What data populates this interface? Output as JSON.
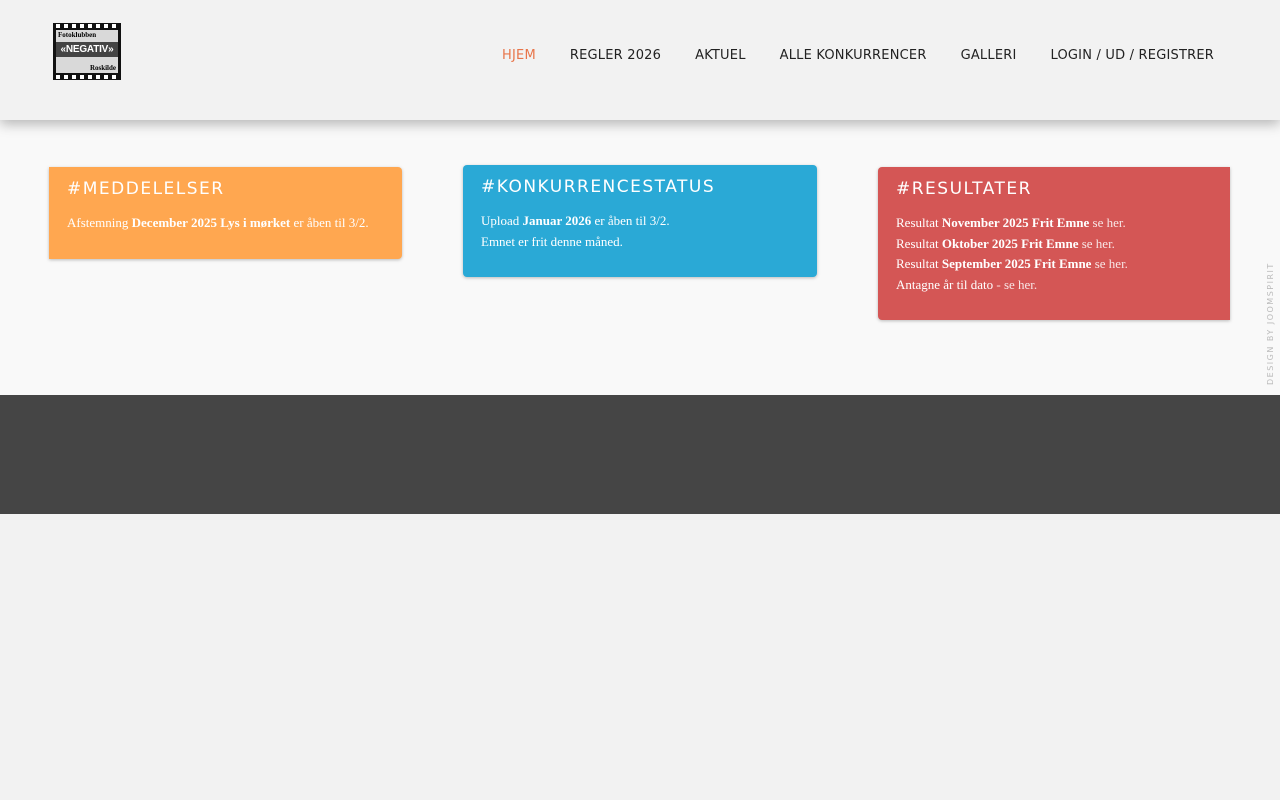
{
  "logo": {
    "line1": "Fotoklubben",
    "line2": "«NEGATIV»",
    "line3": "Roskilde"
  },
  "nav": [
    {
      "label": "HJEM",
      "active": true
    },
    {
      "label": "REGLER 2026"
    },
    {
      "label": "AKTUEL"
    },
    {
      "label": "ALLE KONKURRENCER"
    },
    {
      "label": "GALLERI"
    },
    {
      "label": "LOGIN / UD / REGISTRER"
    }
  ],
  "cards": {
    "meddelelser": {
      "title": "#MEDDELELSER",
      "prefix": "Afstemning ",
      "bold": "December 2025 Lys i mørket",
      "suffix": " er åben til 3/2."
    },
    "konkurrencestatus": {
      "title": "#KONKURRENCESTATUS",
      "line1_prefix": "Upload ",
      "line1_bold": "Januar 2026",
      "line1_suffix": " er åben til 3/2.",
      "line2": "Emnet er frit denne måned."
    },
    "resultater": {
      "title": "#RESULTATER",
      "items": [
        {
          "prefix": "Resultat ",
          "bold": "November 2025 Frit Emne",
          "link": " se her."
        },
        {
          "prefix": "Resultat ",
          "bold": "Oktober 2025 Frit Emne",
          "link": " se her."
        },
        {
          "prefix": "Resultat ",
          "bold": "September 2025 Frit Emne",
          "link": " se her."
        },
        {
          "prefix": "Antagne år til dato",
          "bold": "",
          "link": " - se her."
        }
      ]
    }
  },
  "design_credit": "DESIGN BY JOOMSPIRIT",
  "colors": {
    "accent": "#e8754a",
    "orange_card": "#ffa750",
    "blue_card": "#2aa9d6",
    "red_card": "#d45655",
    "footer": "#454545"
  }
}
